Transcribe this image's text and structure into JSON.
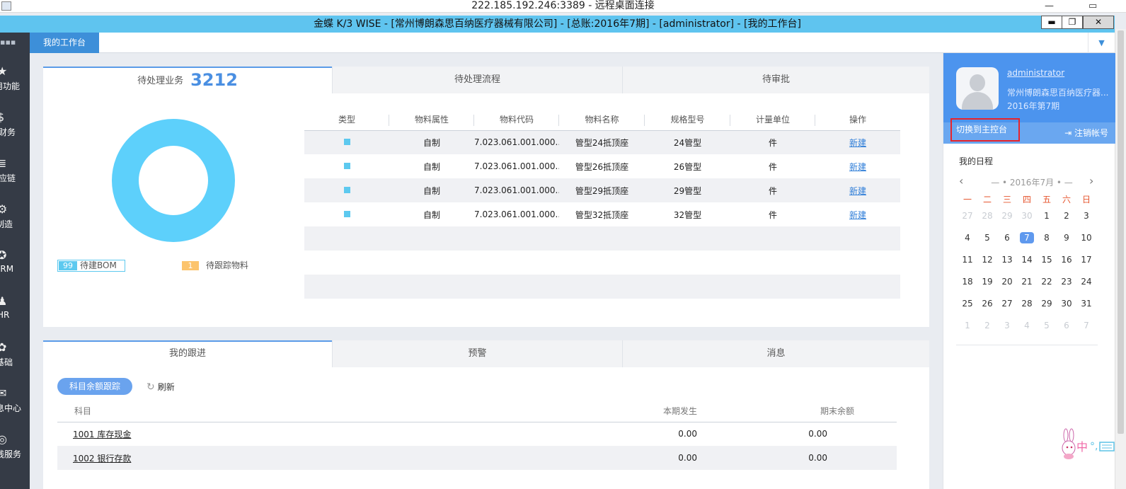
{
  "rdp": {
    "title": "222.185.192.246:3389 - 远程桌面连接",
    "min": "—",
    "max": "▭"
  },
  "app": {
    "title": "金蝶 K/3 WISE - [常州博朗森思百纳医疗器械有限公司] - [总账:2016年7期] - [administrator] - [我的工作台]",
    "min": "▬",
    "max": "❐",
    "close": "✕"
  },
  "sidebar": {
    "items": [
      {
        "label": "用功能",
        "icon": "star-icon"
      },
      {
        "label": "财务",
        "icon": "dollar-icon"
      },
      {
        "label": "应链",
        "icon": "database-icon"
      },
      {
        "label": "制造",
        "icon": "gear-icon"
      },
      {
        "label": "CRM",
        "icon": "crm-icon"
      },
      {
        "label": "HR",
        "icon": "people-icon"
      },
      {
        "label": "基础",
        "icon": "settings-icon"
      },
      {
        "label": "息中心",
        "icon": "mail-icon"
      },
      {
        "label": "线服务",
        "icon": "service-icon"
      }
    ]
  },
  "tabs": {
    "active": "我的工作台"
  },
  "pending": {
    "tabs": [
      "待处理业务",
      "待处理流程",
      "待审批"
    ],
    "count": "3212",
    "legend": [
      {
        "num": "99",
        "label": "待建BOM",
        "color": "#5dc9ef"
      },
      {
        "num": "1",
        "label": "待跟踪物料",
        "color": "#fcc46d"
      }
    ],
    "columns": [
      "类型",
      "物料属性",
      "物料代码",
      "物料名称",
      "规格型号",
      "计量单位",
      "操作"
    ],
    "rows": [
      {
        "attr": "自制",
        "code": "7.023.061.001.000...",
        "name": "管型24抵顶座",
        "spec": "24管型",
        "unit": "件",
        "op": "新建"
      },
      {
        "attr": "自制",
        "code": "7.023.061.001.000...",
        "name": "管型26抵顶座",
        "spec": "26管型",
        "unit": "件",
        "op": "新建"
      },
      {
        "attr": "自制",
        "code": "7.023.061.001.000...",
        "name": "管型29抵顶座",
        "spec": "29管型",
        "unit": "件",
        "op": "新建"
      },
      {
        "attr": "自制",
        "code": "7.023.061.001.000...",
        "name": "管型32抵顶座",
        "spec": "32管型",
        "unit": "件",
        "op": "新建"
      }
    ]
  },
  "follow": {
    "tabs": [
      "我的跟进",
      "预警",
      "消息"
    ],
    "pill": "科目余额跟踪",
    "refresh": "刷新",
    "columns": [
      "科目",
      "本期发生",
      "期末余额"
    ],
    "rows": [
      {
        "subject": "1001 库存现金",
        "current": "0.00",
        "ending": "0.00"
      },
      {
        "subject": "1002 银行存款",
        "current": "0.00",
        "ending": "0.00"
      }
    ]
  },
  "user": {
    "name": "administrator",
    "company": "常州博朗森思百纳医疗器...",
    "period": "2016年第7期",
    "switch": "切换到主控台",
    "logout": "注销帐号"
  },
  "calendar": {
    "title": "我的日程",
    "month": "2016年7月",
    "weekdays": [
      "一",
      "二",
      "三",
      "四",
      "五",
      "六",
      "日"
    ],
    "weeks": [
      [
        "27",
        "28",
        "29",
        "30",
        "1",
        "2",
        "3"
      ],
      [
        "4",
        "5",
        "6",
        "7",
        "8",
        "9",
        "10"
      ],
      [
        "11",
        "12",
        "13",
        "14",
        "15",
        "16",
        "17"
      ],
      [
        "18",
        "19",
        "20",
        "21",
        "22",
        "23",
        "24"
      ],
      [
        "25",
        "26",
        "27",
        "28",
        "29",
        "30",
        "31"
      ],
      [
        "1",
        "2",
        "3",
        "4",
        "5",
        "6",
        "7"
      ]
    ],
    "today": "7"
  },
  "ime": {
    "label": "中"
  }
}
